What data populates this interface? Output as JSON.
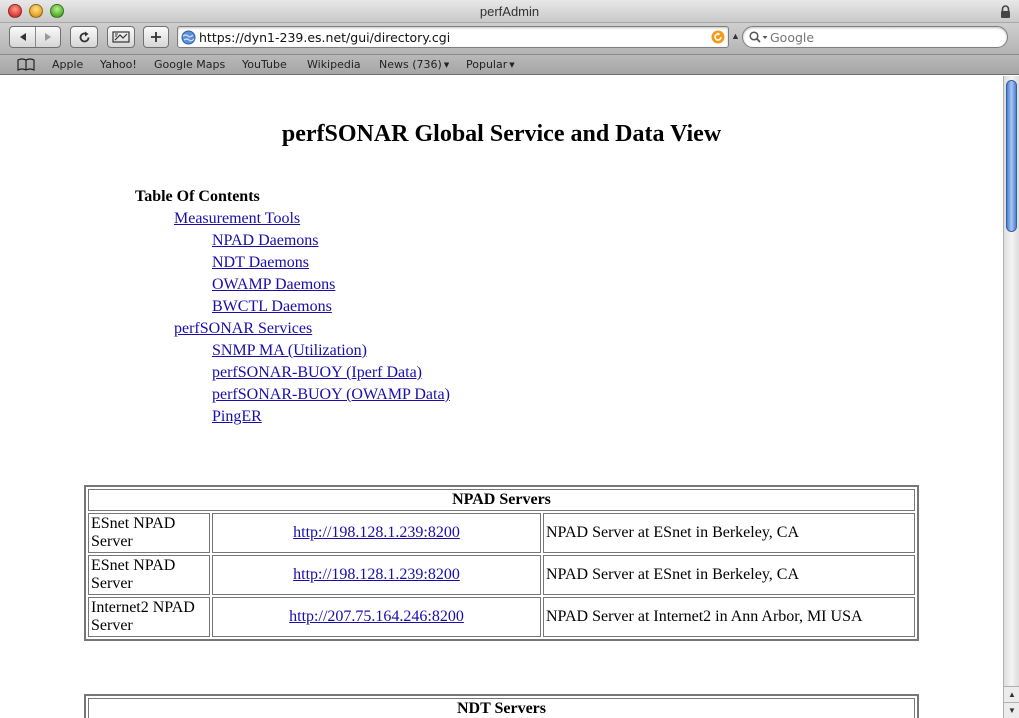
{
  "window": {
    "title": "perfAdmin"
  },
  "toolbar": {
    "url": "https://dyn1-239.es.net/gui/directory.cgi",
    "search_placeholder": "Google",
    "icons": [
      "back-icon",
      "forward-icon",
      "reload-icon",
      "snapback-icon",
      "add-bookmark-icon"
    ]
  },
  "bookmarks": [
    {
      "label": "Apple"
    },
    {
      "label": "Yahoo!"
    },
    {
      "label": "Google Maps"
    },
    {
      "label": "YouTube"
    },
    {
      "label": "Wikipedia"
    },
    {
      "label": "News (736)",
      "menu": true
    },
    {
      "label": "Popular",
      "menu": true
    }
  ],
  "page": {
    "title": "perfSONAR Global Service and Data View",
    "toc_heading": "Table Of Contents",
    "toc": [
      {
        "label": "Measurement Tools",
        "level": 1
      },
      {
        "label": "NPAD Daemons",
        "level": 2
      },
      {
        "label": "NDT Daemons",
        "level": 2
      },
      {
        "label": "OWAMP Daemons",
        "level": 2
      },
      {
        "label": "BWCTL Daemons",
        "level": 2
      },
      {
        "label": "perfSONAR Services",
        "level": 1
      },
      {
        "label": "SNMP MA (Utilization)",
        "level": 2
      },
      {
        "label": "perfSONAR-BUOY (Iperf Data)",
        "level": 2
      },
      {
        "label": "perfSONAR-BUOY (OWAMP Data)",
        "level": 2
      },
      {
        "label": "PingER",
        "level": 2
      }
    ],
    "npad": {
      "heading": "NPAD Servers",
      "rows": [
        {
          "name": "ESnet NPAD Server",
          "url": "http://198.128.1.239:8200",
          "desc": "NPAD Server at ESnet in Berkeley, CA"
        },
        {
          "name": "ESnet NPAD Server",
          "url": "http://198.128.1.239:8200",
          "desc": "NPAD Server at ESnet in Berkeley, CA"
        },
        {
          "name": "Internet2 NPAD Server",
          "url": "http://207.75.164.246:8200",
          "desc": "NPAD Server at Internet2 in Ann Arbor, MI USA"
        }
      ]
    },
    "ndt": {
      "heading": "NDT Servers"
    }
  },
  "colors": {
    "link": "#1a0dab",
    "scroll_thumb": "#4d7fd1"
  }
}
